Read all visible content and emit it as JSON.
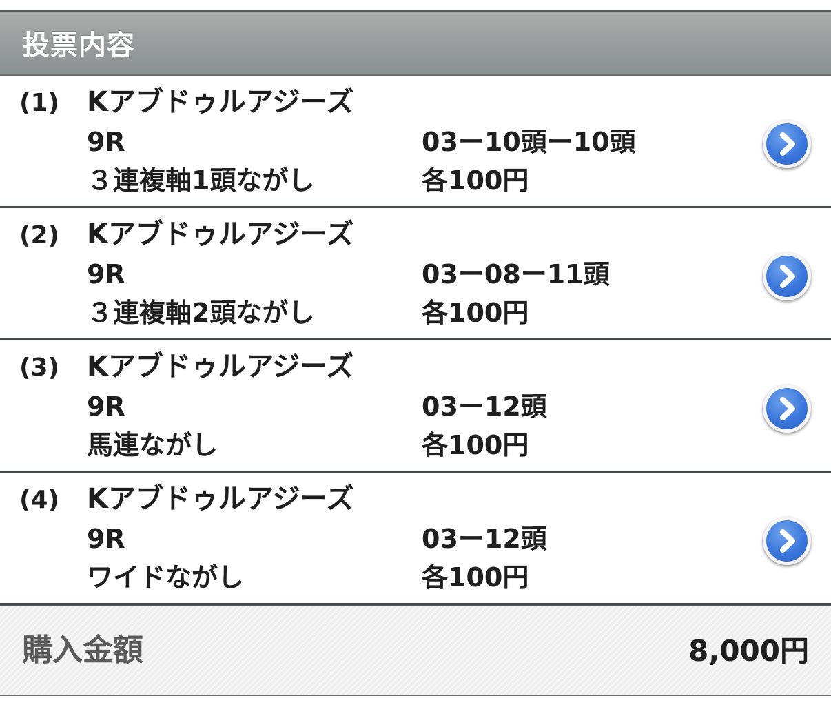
{
  "header": {
    "title": "投票内容"
  },
  "bets": [
    {
      "num": "(1)",
      "horse": "Kアブドゥルアジーズ",
      "race": "9R",
      "combo": "03ー10頭ー10頭",
      "type": "３連複軸1頭ながし",
      "amount": "各100円"
    },
    {
      "num": "(2)",
      "horse": "Kアブドゥルアジーズ",
      "race": "9R",
      "combo": "03ー08ー11頭",
      "type": "３連複軸2頭ながし",
      "amount": "各100円"
    },
    {
      "num": "(3)",
      "horse": "Kアブドゥルアジーズ",
      "race": "9R",
      "combo": "03ー12頭",
      "type": "馬連ながし",
      "amount": "各100円"
    },
    {
      "num": "(4)",
      "horse": "Kアブドゥルアジーズ",
      "race": "9R",
      "combo": "03ー12頭",
      "type": "ワイドながし",
      "amount": "各100円"
    }
  ],
  "footer": {
    "label": "購入金額",
    "total": "8,000円"
  },
  "icons": {
    "detail": "chevron-right-circle-icon"
  },
  "colors": {
    "header_bg": "#9a9e9e",
    "accent_blue": "#3c78dc"
  }
}
